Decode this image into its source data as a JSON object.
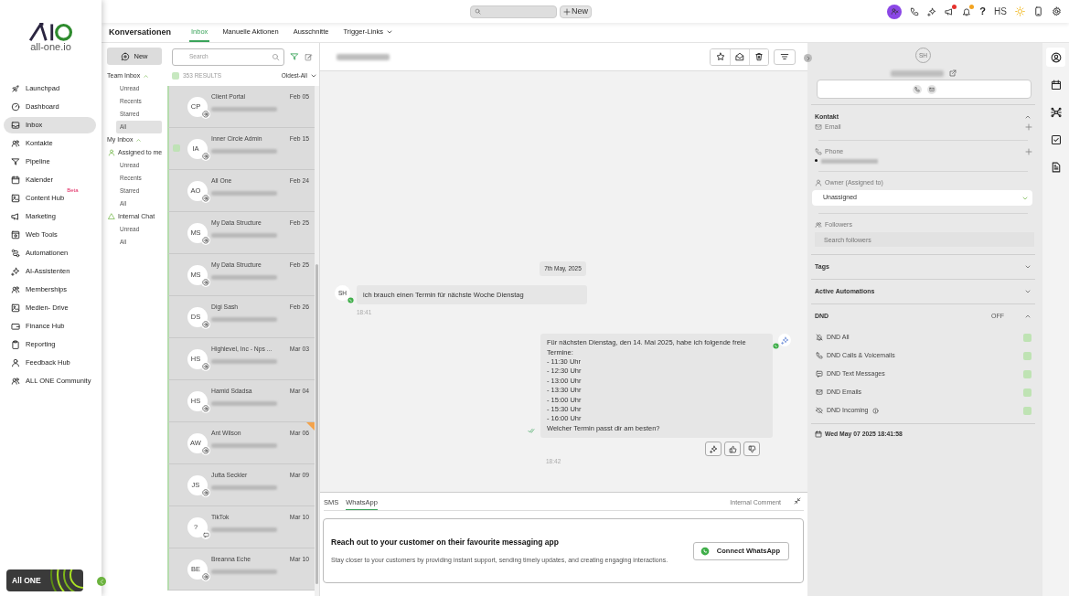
{
  "brand": {
    "logo_text": "all-one.io",
    "badge": "All ONE"
  },
  "nav": [
    {
      "label": "Launchpad",
      "selected": false
    },
    {
      "label": "Dashboard",
      "selected": false
    },
    {
      "label": "Inbox",
      "selected": true
    },
    {
      "label": "Kontakte",
      "selected": false
    },
    {
      "label": "Pipeline",
      "selected": false
    },
    {
      "label": "Kalender",
      "selected": false
    },
    {
      "label": "Content Hub",
      "badge": "Beta",
      "selected": false
    },
    {
      "label": "Marketing",
      "selected": false
    },
    {
      "label": "Web Tools",
      "selected": false
    },
    {
      "label": "Automationen",
      "selected": false
    },
    {
      "label": "AI-Assistenten",
      "selected": false
    },
    {
      "label": "Memberships",
      "selected": false
    },
    {
      "label": "Medien- Drive",
      "selected": false
    },
    {
      "label": "Finance Hub",
      "selected": false
    },
    {
      "label": "Reporting",
      "selected": false
    },
    {
      "label": "Feedback Hub",
      "selected": false
    },
    {
      "label": "ALL ONE Community",
      "selected": false
    }
  ],
  "topbar": {
    "new_button": "New",
    "help": "?",
    "user_initials": "HS",
    "megaphone_unread": true,
    "bell_unread": true
  },
  "header": {
    "title": "Konversationen",
    "tabs": [
      {
        "label": "Inbox",
        "selected": true,
        "has_menu": false
      },
      {
        "label": "Manuelle Aktionen",
        "selected": false,
        "has_menu": false
      },
      {
        "label": "Ausschnitte",
        "selected": false,
        "has_menu": false
      },
      {
        "label": "Trigger-Links",
        "selected": false,
        "has_menu": true
      }
    ]
  },
  "inbox_nav": {
    "new_button": "New",
    "sections": [
      {
        "label": "Team Inbox",
        "expanded": true,
        "children": [
          {
            "label": "Unread",
            "selected": false
          },
          {
            "label": "Recents",
            "selected": false
          },
          {
            "label": "Starred",
            "selected": false
          },
          {
            "label": "All",
            "selected": true
          }
        ]
      },
      {
        "label": "My Inbox",
        "expanded": true,
        "children": [
          {
            "label": "Assigned to me",
            "children": [
              {
                "label": "Unread",
                "selected": false
              },
              {
                "label": "Recents",
                "selected": false
              },
              {
                "label": "Starred",
                "selected": false
              },
              {
                "label": "All",
                "selected": false
              }
            ]
          },
          {
            "label": "Internal Chat",
            "children": [
              {
                "label": "Unread",
                "selected": false
              },
              {
                "label": "All",
                "selected": false
              }
            ]
          }
        ]
      }
    ]
  },
  "conversations": {
    "search_placeholder": "Search",
    "select_all_checked": false,
    "results": "353 RESULTS",
    "sort": "Oldest-All",
    "items": [
      {
        "initials": "CP",
        "name": "Client Portal",
        "date": "Feb 05",
        "kind": "email",
        "hovered": false,
        "flagged": false
      },
      {
        "initials": "IA",
        "name": "Inner Circle Admin",
        "date": "Feb 15",
        "kind": "email",
        "hovered": true,
        "flagged": false
      },
      {
        "initials": "AO",
        "name": "All One",
        "date": "Feb 24",
        "kind": "email",
        "hovered": false,
        "flagged": false
      },
      {
        "initials": "MS",
        "name": "My Data Structure",
        "date": "Feb 25",
        "kind": "email",
        "hovered": false,
        "flagged": false
      },
      {
        "initials": "MS",
        "name": "My Data Structure",
        "date": "Feb 25",
        "kind": "email",
        "hovered": false,
        "flagged": false
      },
      {
        "initials": "DS",
        "name": "Digi Sash",
        "date": "Feb 26",
        "kind": "email",
        "hovered": false,
        "flagged": false
      },
      {
        "initials": "HS",
        "name": "Highlevel, Inc - Nps ...",
        "date": "Mar 03",
        "kind": "email",
        "hovered": false,
        "flagged": false
      },
      {
        "initials": "HS",
        "name": "Hamid Sdadsa",
        "date": "Mar 04",
        "kind": "email",
        "hovered": false,
        "flagged": false
      },
      {
        "initials": "AW",
        "name": "Ant Wilson",
        "date": "Mar 06",
        "kind": "email",
        "hovered": false,
        "flagged": true
      },
      {
        "initials": "JS",
        "name": "Jutta Seckler",
        "date": "Mar 09",
        "kind": "email",
        "hovered": false,
        "flagged": false
      },
      {
        "initials": "?",
        "name": "TikTok",
        "date": "Mar 10",
        "kind": "chat",
        "hovered": false,
        "flagged": false
      },
      {
        "initials": "BE",
        "name": "Breanna Eche",
        "date": "Mar 10",
        "kind": "email",
        "hovered": false,
        "flagged": false
      }
    ]
  },
  "chat": {
    "date_chip": "7th May, 2025",
    "messages": [
      {
        "kind": "in",
        "initials": "SH",
        "text": "ich brauch einen Termin für nächste Woche Dienstag",
        "time": "18:41"
      },
      {
        "kind": "out",
        "text": "Für nächsten Dienstag, den 14. Mai 2025, habe ich folgende freie Termine:\n- 11:30 Uhr\n- 12:30 Uhr\n- 13:00 Uhr\n- 13:30 Uhr\n- 15:00 Uhr\n- 15:30 Uhr\n- 16:00 Uhr\nWelcher Termin passt dir am besten?",
        "time": "18:42"
      }
    ],
    "composer": {
      "tabs": [
        {
          "label": "SMS",
          "selected": false
        },
        {
          "label": "WhatsApp",
          "selected": true
        }
      ],
      "internal_comment": "Internal Comment",
      "promo_title": "Reach out to your customer on their favourite messaging app",
      "promo_text": "Stay closer to your customers by providing instant support, sending timely updates, and creating engaging interactions.",
      "connect_button": "Connect WhatsApp"
    }
  },
  "contact": {
    "initials": "SH",
    "kontakt": {
      "title": "Kontakt",
      "expanded": true,
      "email_label": "Email",
      "phone_label": "Phone",
      "owner_label": "Owner (Assigned to)",
      "owner_value": "Unassigned",
      "followers_label": "Followers",
      "followers_placeholder": "Search followers"
    },
    "collapsed_sections": [
      {
        "title": "Tags",
        "expanded": false
      },
      {
        "title": "Active Automations",
        "expanded": false
      }
    ],
    "dnd": {
      "title": "DND",
      "status": "OFF",
      "expanded": true,
      "options": [
        {
          "label": "DND All",
          "on": false,
          "info": false
        },
        {
          "label": "DND Calls & Voicemails",
          "on": false,
          "info": false
        },
        {
          "label": "DND Text Messages",
          "on": false,
          "info": false
        },
        {
          "label": "DND Emails",
          "on": false,
          "info": false
        },
        {
          "label": "DND Incoming",
          "on": false,
          "info": true
        }
      ]
    },
    "created": "Wed May 07 2025 18:41:58"
  },
  "rail": [
    {
      "selected": true
    },
    {
      "selected": false
    },
    {
      "selected": false
    },
    {
      "selected": false
    },
    {
      "selected": false
    }
  ]
}
